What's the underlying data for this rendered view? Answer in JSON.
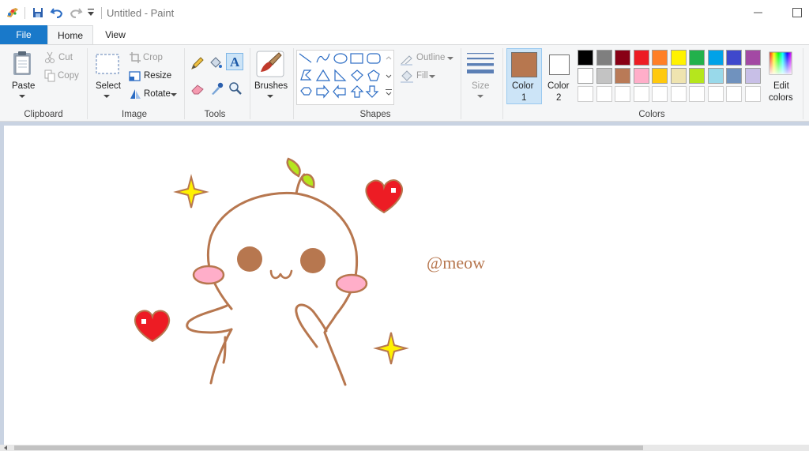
{
  "window": {
    "title": "Untitled - Paint"
  },
  "menu": {
    "file": "File",
    "home": "Home",
    "view": "View"
  },
  "clipboard": {
    "paste": "Paste",
    "cut": "Cut",
    "copy": "Copy",
    "label": "Clipboard"
  },
  "image": {
    "select": "Select",
    "crop": "Crop",
    "resize": "Resize",
    "rotate": "Rotate",
    "label": "Image"
  },
  "tools": {
    "label": "Tools"
  },
  "brushes": {
    "label": "Brushes"
  },
  "shapes": {
    "outline": "Outline",
    "fill": "Fill",
    "label": "Shapes"
  },
  "size": {
    "label": "Size"
  },
  "colors": {
    "color1_label": "Color",
    "color1_num": "1",
    "color2_label": "Color",
    "color2_num": "2",
    "color1": "#b7774f",
    "color2": "#ffffff",
    "edit_label": "Edit",
    "edit_label2": "colors",
    "label": "Colors",
    "row1": [
      "#000000",
      "#7f7f7f",
      "#880015",
      "#ed1c24",
      "#ff7f27",
      "#fff200",
      "#22b14c",
      "#00a2e8",
      "#3f48cc",
      "#a349a4"
    ],
    "row2": [
      "#ffffff",
      "#c3c3c3",
      "#b97a57",
      "#ffaec9",
      "#ffc90e",
      "#efe4b0",
      "#b5e61d",
      "#99d9ea",
      "#7092be",
      "#c8bfe7"
    ]
  },
  "canvas_text": {
    "watermark": "@meow"
  }
}
